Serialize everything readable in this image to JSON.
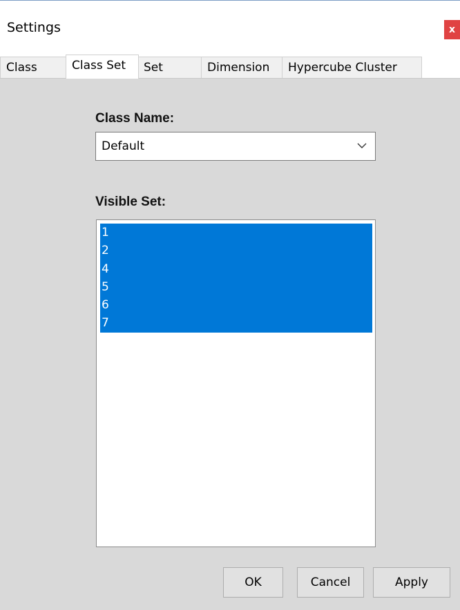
{
  "window": {
    "title": "Settings",
    "close_glyph": "x"
  },
  "tabs": [
    {
      "label": "Class",
      "active": false
    },
    {
      "label": "Class Set",
      "active": true
    },
    {
      "label": "Set",
      "active": false
    },
    {
      "label": "Dimension",
      "active": false
    },
    {
      "label": "Hypercube Cluster",
      "active": false
    }
  ],
  "form": {
    "class_name_label": "Class Name:",
    "class_name_value": "Default",
    "visible_set_label": "Visible Set:",
    "visible_set_items": [
      "1",
      "2",
      "4",
      "5",
      "6",
      "7"
    ]
  },
  "buttons": {
    "ok": "OK",
    "cancel": "Cancel",
    "apply": "Apply"
  },
  "colors": {
    "selection": "#0078d7",
    "close_button": "#e04343",
    "panel_background": "#d9d9d9"
  }
}
